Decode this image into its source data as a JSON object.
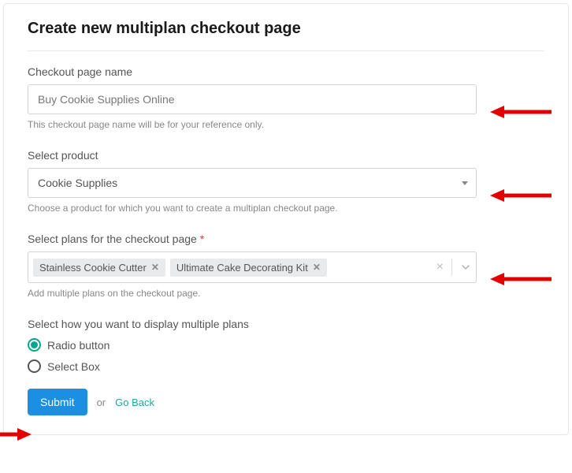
{
  "header": {
    "title": "Create new multiplan checkout page"
  },
  "name_field": {
    "label": "Checkout page name",
    "value": "Buy Cookie Supplies Online",
    "help": "This checkout page name will be for your reference only."
  },
  "product_field": {
    "label": "Select product",
    "value": "Cookie Supplies",
    "help": "Choose a product for which you want to create a multiplan checkout page."
  },
  "plans_field": {
    "label": "Select plans for the checkout page",
    "required_mark": "*",
    "tags": [
      "Stainless Cookie Cutter",
      "Ultimate Cake Decorating Kit"
    ],
    "help": "Add multiple plans on the checkout page."
  },
  "display_field": {
    "label": "Select how you want to display multiple plans",
    "options": [
      "Radio button",
      "Select Box"
    ],
    "selected": "Radio button"
  },
  "actions": {
    "submit": "Submit",
    "or": "or",
    "back": "Go Back"
  }
}
